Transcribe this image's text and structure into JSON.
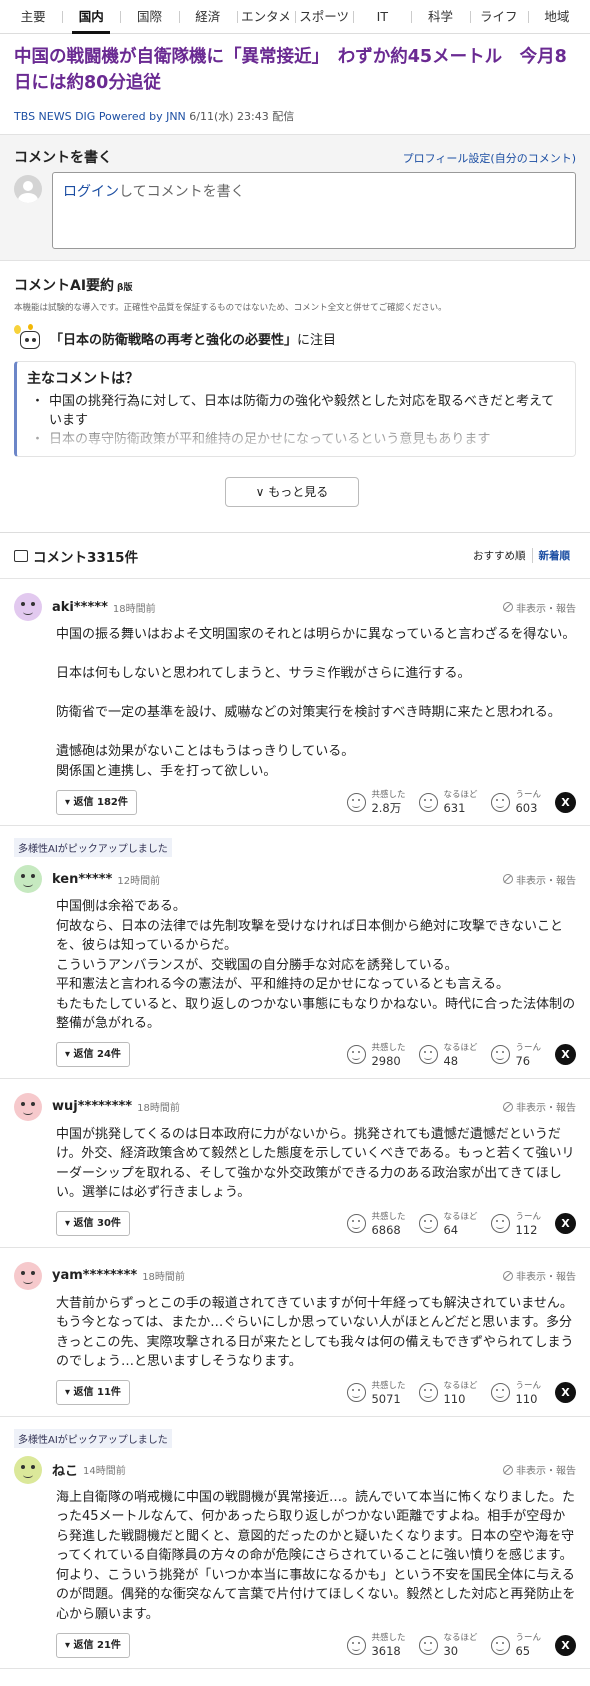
{
  "nav": [
    {
      "label": "主要",
      "active": false
    },
    {
      "label": "国内",
      "active": true
    },
    {
      "label": "国際",
      "active": false
    },
    {
      "label": "経済",
      "active": false
    },
    {
      "label": "エンタメ",
      "active": false
    },
    {
      "label": "スポーツ",
      "active": false
    },
    {
      "label": "IT",
      "active": false
    },
    {
      "label": "科学",
      "active": false
    },
    {
      "label": "ライフ",
      "active": false
    },
    {
      "label": "地域",
      "active": false
    }
  ],
  "article": {
    "title": "中国の戦闘機が自衛隊機に「異常接近」　わずか約45メートル　今月8日には約80分追従",
    "source": "TBS NEWS DIG Powered by JNN",
    "date": "6/11(水) 23:43 配信"
  },
  "write": {
    "title": "コメントを書く",
    "profile_link": "プロフィール設定(自分のコメント)",
    "login": "ログイン",
    "placeholder_rest": "してコメントを書く"
  },
  "ai": {
    "title": "コメントAI要約",
    "beta": "β版",
    "note": "本機能は試験的な導入です。正確性や品質を保証するものではないため、コメント全文と併せてご確認ください。",
    "focus_topic": "「日本の防衛戦略の再考と強化の必要性」",
    "focus_suffix": "に注目",
    "main_title": "主なコメントは？",
    "points": [
      "中国の挑発行為に対して、日本は防衛力の強化や毅然とした対応を取るべきだと考えています",
      "日本の専守防衛政策が平和維持の足かせになっているという意見もあります"
    ],
    "more_label": "もっと見る"
  },
  "comments_header": {
    "title": "コメント",
    "count": "3315件",
    "sort_recommended": "おすすめ順",
    "sort_new": "新着順"
  },
  "labels": {
    "report": "非表示・報告",
    "empathy": "共感した",
    "insight": "なるほど",
    "hmm": "うーん",
    "picked": "多様性AIがピックアップしました",
    "x_icon": "X"
  },
  "colors": {
    "title_purple": "#6a2a92",
    "link_blue": "#1d4fa3",
    "avatar_purple": "#e2c9ef",
    "avatar_green": "#c6e9c0",
    "avatar_pink": "#f6c9cc",
    "avatar_olive": "#dbe89a"
  },
  "comments": [
    {
      "user": "aki*****",
      "time": "18時間前",
      "picked": false,
      "avatar_color": "#e2c9ef",
      "body": "中国の振る舞いはおよそ文明国家のそれとは明らかに異なっていると言わざるを得ない。\n\n日本は何もしないと思われてしまうと、サラミ作戦がさらに進行する。\n\n防衛省で一定の基準を設け、威嚇などの対策実行を検討すべき時期に来たと思われる。\n\n遺憾砲は効果がないことはもうはっきりしている。\n関係国と連携し、手を打って欲しい。",
      "replies": "返信 182件",
      "empathy": "2.8万",
      "insight": "631",
      "hmm": "603"
    },
    {
      "user": "ken*****",
      "time": "12時間前",
      "picked": true,
      "avatar_color": "#c6e9c0",
      "body": "中国側は余裕である。\n何故なら、日本の法律では先制攻撃を受けなければ日本側から絶対に攻撃できないことを、彼らは知っているからだ。\nこういうアンバランスが、交戦国の自分勝手な対応を誘発している。\n平和憲法と言われる今の憲法が、平和維持の足かせになっているとも言える。\nもたもたしていると、取り返しのつかない事態にもなりかねない。時代に合った法体制の整備が急がれる。",
      "replies": "返信 24件",
      "empathy": "2980",
      "insight": "48",
      "hmm": "76"
    },
    {
      "user": "wuj********",
      "time": "18時間前",
      "picked": false,
      "avatar_color": "#f6c9cc",
      "body": "中国が挑発してくるのは日本政府に力がないから。挑発されても遺憾だ遺憾だというだけ。外交、経済政策含めて毅然とした態度を示していくべきである。もっと若くて強いリーダーシップを取れる、そして強かな外交政策ができる力のある政治家が出てきてほしい。選挙には必ず行きましょう。",
      "replies": "返信 30件",
      "empathy": "6868",
      "insight": "64",
      "hmm": "112"
    },
    {
      "user": "yam********",
      "time": "18時間前",
      "picked": false,
      "avatar_color": "#f6c9cc",
      "body": "大昔前からずっとこの手の報道されてきていますが何十年経っても解決されていません。もう今となっては、またか…ぐらいにしか思っていない人がほとんどだと思います。多分きっとこの先、実際攻撃される日が来たとしても我々は何の備えもできずやられてしまうのでしょう…と思いますしそうなります。",
      "replies": "返信 11件",
      "empathy": "5071",
      "insight": "110",
      "hmm": "110"
    },
    {
      "user": "ねこ",
      "time": "14時間前",
      "picked": true,
      "avatar_color": "#dbe89a",
      "body": "海上自衛隊の哨戒機に中国の戦闘機が異常接近…。読んでいて本当に怖くなりました。たった45メートルなんて、何かあったら取り返しがつかない距離ですよね。相手が空母から発進した戦闘機だと聞くと、意図的だったのかと疑いたくなります。日本の空や海を守ってくれている自衛隊員の方々の命が危険にさらされていることに強い憤りを感じます。何より、こういう挑発が「いつか本当に事故になるかも」という不安を国民全体に与えるのが問題。偶発的な衝突なんて言葉で片付けてほしくない。毅然とした対応と再発防止を心から願います。",
      "replies": "返信 21件",
      "empathy": "3618",
      "insight": "30",
      "hmm": "65"
    }
  ]
}
